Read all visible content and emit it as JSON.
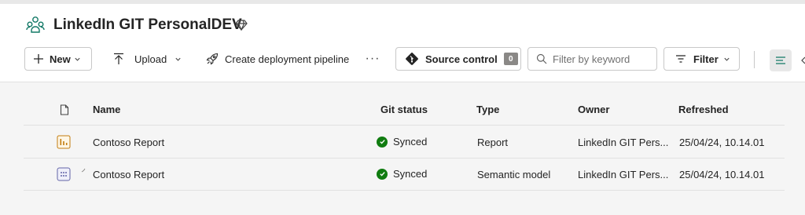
{
  "workspace": {
    "title": "LinkedIn GIT PersonalDEV"
  },
  "toolbar": {
    "new_label": "New",
    "upload_label": "Upload",
    "deploy_label": "Create deployment pipeline",
    "more_label": "···",
    "source_control_label": "Source control",
    "source_control_count": "0",
    "search_placeholder": "Filter by keyword",
    "filter_label": "Filter"
  },
  "table": {
    "columns": {
      "name": "Name",
      "git_status": "Git status",
      "type": "Type",
      "owner": "Owner",
      "refreshed": "Refreshed"
    },
    "rows": [
      {
        "icon": "report-icon",
        "name": "Contoso Report",
        "git_status": "Synced",
        "type": "Report",
        "owner": "LinkedIn GIT Pers...",
        "refreshed": "25/04/24, 10.14.01"
      },
      {
        "icon": "semantic-model-icon",
        "name": "Contoso Report",
        "git_status": "Synced",
        "type": "Semantic model",
        "owner": "LinkedIn GIT Pers...",
        "refreshed": "25/04/24, 10.14.01"
      }
    ]
  },
  "colors": {
    "synced": "#107c10",
    "report_icon": "#c27c0e",
    "model_icon": "#6264a7",
    "accent": "#117865"
  }
}
